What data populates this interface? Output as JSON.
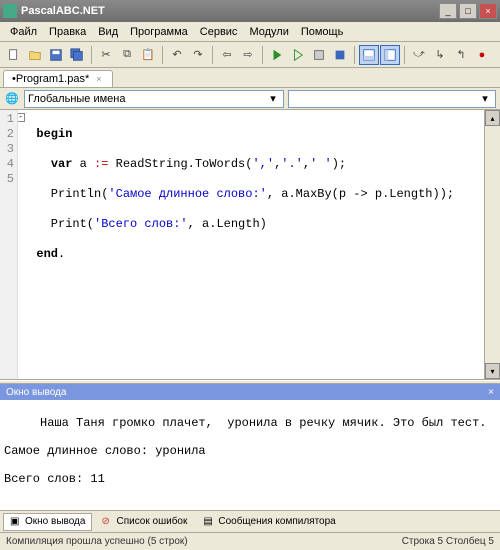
{
  "window": {
    "title": "PascalABC.NET"
  },
  "menu": [
    "Файл",
    "Правка",
    "Вид",
    "Программа",
    "Сервис",
    "Модули",
    "Помощь"
  ],
  "tabs": [
    {
      "label": "•Program1.pas*"
    }
  ],
  "nav": {
    "combo": "Глобальные имена"
  },
  "code": {
    "lines": [
      1,
      2,
      3,
      4,
      5
    ],
    "l1_kw": "begin",
    "l2_kw": "var",
    "l2_a": " a ",
    "l2_op": ":=",
    "l2_b": " ReadString.ToWords(",
    "l2_s1": "','",
    "l2_c": ",",
    "l2_s2": "'.'",
    "l2_d": ",",
    "l2_s3": "' '",
    "l2_e": ");",
    "l3_a": "    Println(",
    "l3_s": "'Самое длинное слово:'",
    "l3_b": ", a.MaxBy(p -> p.Length));",
    "l4_a": "    Print(",
    "l4_s": "'Всего слов:'",
    "l4_b": ", a.Length)",
    "l5_kw": "end",
    "l5_dot": "."
  },
  "output": {
    "title": "Окно вывода",
    "line1": "     Наша Таня громко плачет,  уронила в речку мячик. Это был тест.",
    "line2": "Самое длинное слово: уронила",
    "line3": "Всего слов: 11"
  },
  "bottom_tabs": [
    {
      "label": "Окно вывода",
      "active": true
    },
    {
      "label": "Список ошибок",
      "active": false
    },
    {
      "label": "Сообщения компилятора",
      "active": false
    }
  ],
  "status": {
    "left": "Компиляция прошла успешно (5 строк)",
    "right": "Строка  5 Столбец  5"
  }
}
